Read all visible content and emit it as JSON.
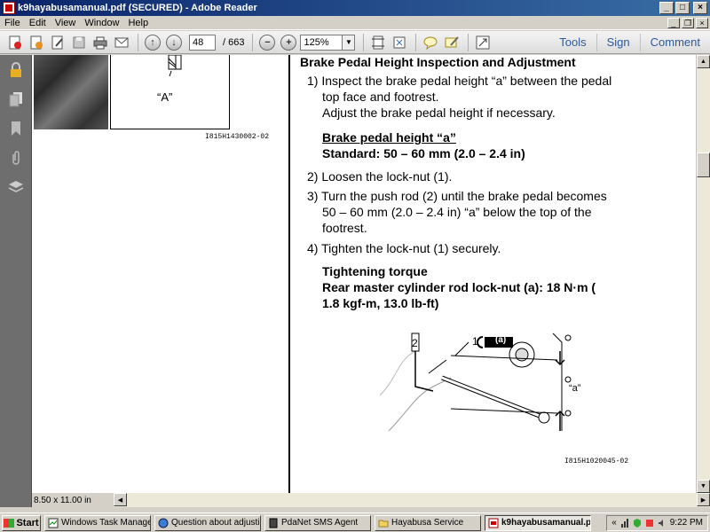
{
  "window": {
    "title": "k9hayabusamanual.pdf (SECURED) - Adobe Reader",
    "min": "_",
    "max": "□",
    "close": "×"
  },
  "menu": [
    "File",
    "Edit",
    "View",
    "Window",
    "Help"
  ],
  "mdi": {
    "min": "_",
    "restore": "❐",
    "close": "×"
  },
  "toolbar": {
    "page_current": "48",
    "page_total": "/ 663",
    "zoom": "125%",
    "links": [
      "Tools",
      "Sign",
      "Comment"
    ]
  },
  "doc": {
    "fig1_label": "“A”",
    "fig1_caption": "I815H1430002-02",
    "heading": "Brake Pedal Height Inspection and Adjustment",
    "step1_l1": "1) Inspect the brake pedal height “a” between the pedal",
    "step1_l2": "top face and footrest.",
    "step1_l3": "Adjust the brake pedal height if necessary.",
    "spec_title": "Brake pedal height “a”",
    "spec_value": "Standard: 50 – 60 mm (2.0 – 2.4 in)",
    "step2": "2) Loosen the lock-nut (1).",
    "step3_l1": "3) Turn the push rod (2) until the brake pedal becomes",
    "step3_l2": "50 – 60 mm (2.0 – 2.4 in) “a” below the top of the",
    "step3_l3": "footrest.",
    "step4": "4) Tighten the lock-nut (1) securely.",
    "torque_title": "Tightening torque",
    "torque_l1": "Rear master cylinder rod lock-nut (a):  18 N·m (",
    "torque_l2": "1.8 kgf-m, 13.0 lb-ft)",
    "fig2_labels": {
      "two": "2",
      "one": "1",
      "a_box": "(a)",
      "a": "“a”"
    },
    "fig2_caption": "I815H1020045-02"
  },
  "status": {
    "page_size": "8.50 x 11.00 in"
  },
  "taskbar": {
    "start": "Start",
    "tasks": [
      "Windows Task Manager",
      "Question about adjustin...",
      "PdaNet SMS Agent",
      "Hayabusa Service",
      "k9hayabusamanual.p..."
    ],
    "tray_chevron": "«",
    "clock": "9:22 PM"
  }
}
